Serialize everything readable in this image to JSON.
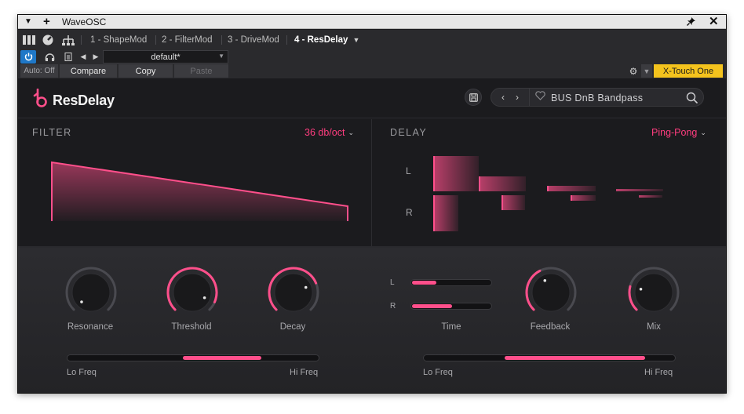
{
  "window": {
    "title": "WaveOSC"
  },
  "host": {
    "tabs": [
      "1 - ShapeMod",
      "2 - FilterMod",
      "3 - DriveMod",
      "4 - ResDelay"
    ],
    "preset_name": "default*",
    "auto_label": "Auto: Off",
    "compare_label": "Compare",
    "copy_label": "Copy",
    "paste_label": "Paste",
    "controller_label": "X-Touch One"
  },
  "plugin": {
    "name": "ResDelay",
    "preset_label": "BUS DnB Bandpass"
  },
  "filter": {
    "section_label": "FILTER",
    "slope_label": "36 db/oct",
    "knobs": [
      {
        "label": "Resonance",
        "value": 0.0
      },
      {
        "label": "Threshold",
        "value": 0.92
      },
      {
        "label": "Decay",
        "value": 0.75
      }
    ],
    "range": {
      "low_label": "Lo Freq",
      "high_label": "Hi Freq",
      "low": 0.46,
      "high": 0.78
    }
  },
  "delay": {
    "section_label": "DELAY",
    "mode_label": "Ping-Pong",
    "channel_labels": {
      "left": "L",
      "right": "R"
    },
    "time": {
      "label": "Time",
      "left": 0.33,
      "right": 0.53
    },
    "knobs": [
      {
        "label": "Feedback",
        "value": 0.4
      },
      {
        "label": "Mix",
        "value": 0.22
      }
    ],
    "range": {
      "low_label": "Lo Freq",
      "high_label": "Hi Freq",
      "low": 0.32,
      "high": 0.89
    }
  },
  "colors": {
    "accent": "#ff4f8b",
    "accent_text": "#ff3d7f",
    "controller_badge": "#f4c31d",
    "power_button": "#1f78c8"
  },
  "icons": [
    "menu-chevron-icon",
    "plus-icon",
    "pin-icon",
    "close-icon",
    "meter-icon",
    "dial-icon",
    "routing-icon",
    "power-icon",
    "headphone-icon",
    "preset-file-icon",
    "prev-arrow-icon",
    "next-arrow-icon",
    "dropdown-chevron-icon",
    "gear-icon",
    "save-icon",
    "heart-icon",
    "search-icon"
  ]
}
